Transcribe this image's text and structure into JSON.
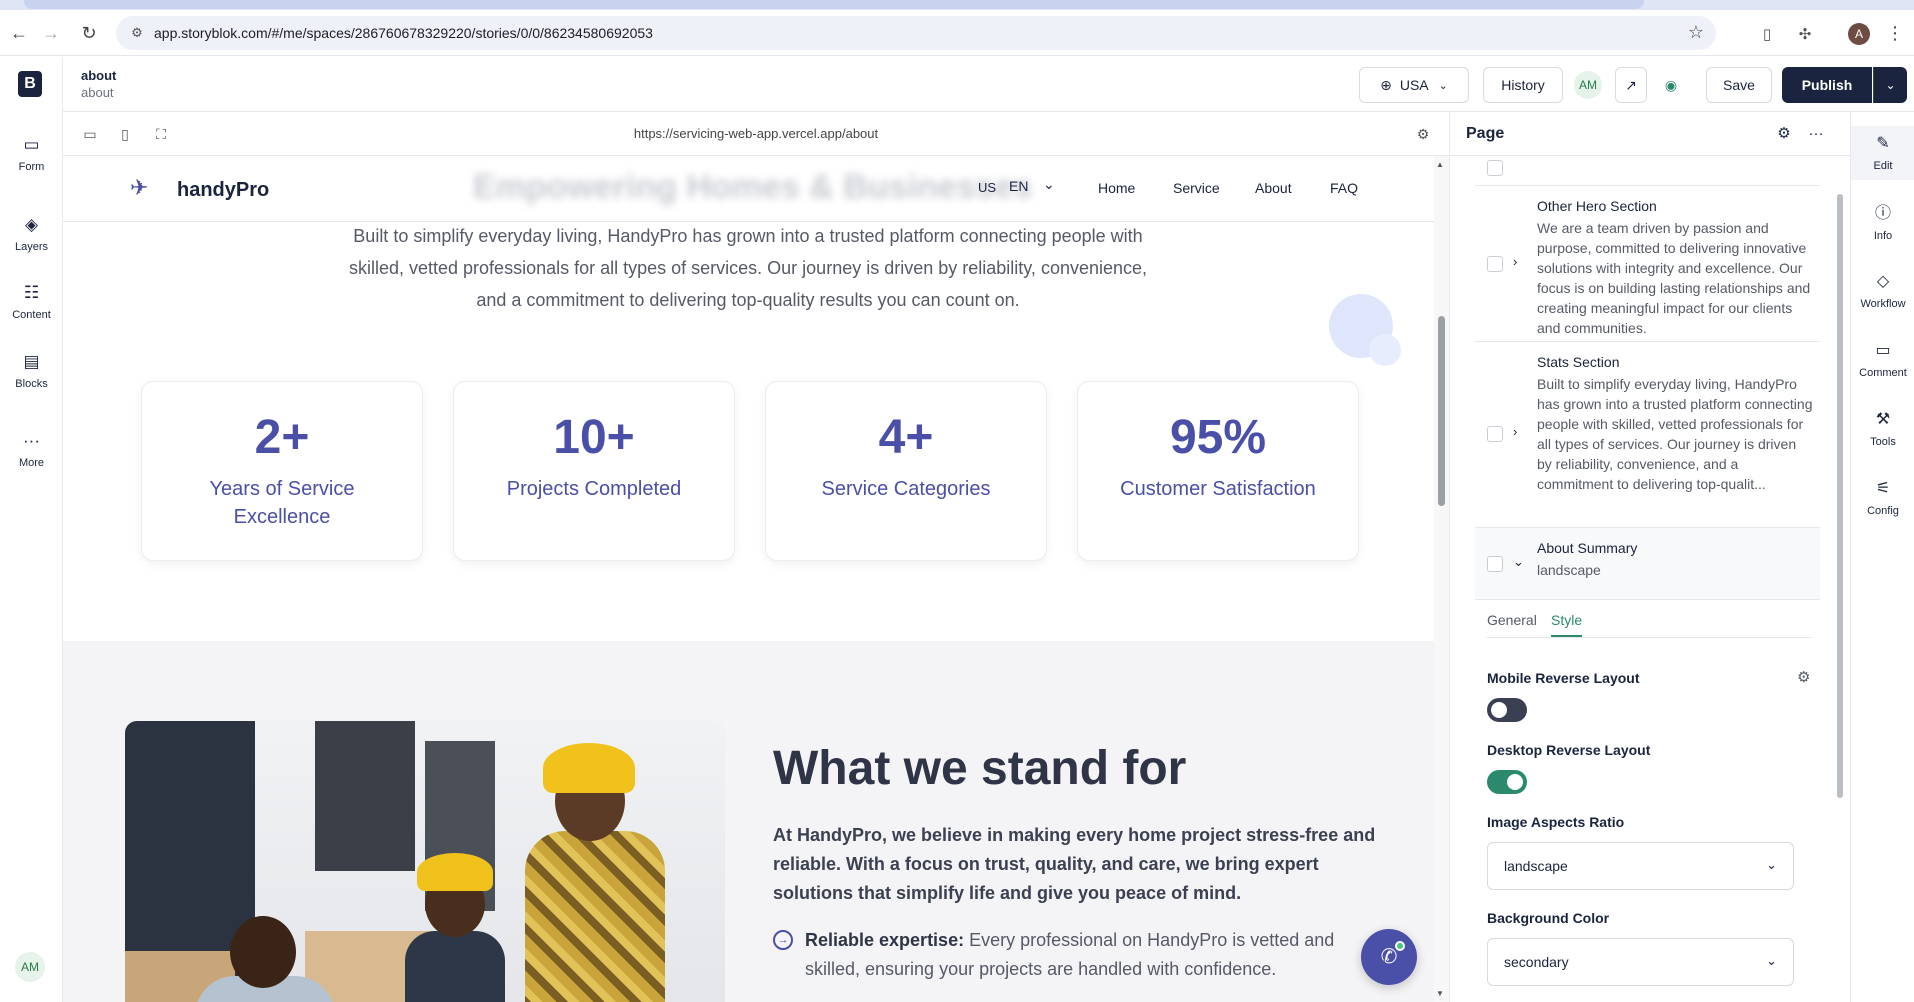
{
  "browser": {
    "url": "app.storyblok.com/#/me/spaces/286760678329220/stories/0/0/86234580692053",
    "profile_initial": "A"
  },
  "leftrail": {
    "logo": "B",
    "items": [
      {
        "label": "Form",
        "icon": "form-icon"
      },
      {
        "label": "Layers",
        "icon": "layers-icon"
      },
      {
        "label": "Content",
        "icon": "content-icon"
      },
      {
        "label": "Blocks",
        "icon": "blocks-icon"
      },
      {
        "label": "More",
        "icon": "more-icon"
      }
    ],
    "user_initials": "AM"
  },
  "header": {
    "story_name": "about",
    "story_slug": "about",
    "language_label": "USA",
    "history_label": "History",
    "collaborator_initials": "AM",
    "save_label": "Save",
    "publish_label": "Publish"
  },
  "preview_bar": {
    "url": "https://servicing-web-app.vercel.app/about"
  },
  "site": {
    "brand": "handyPro",
    "blurred_heading": "Empowering Homes & Businesses",
    "lang_region": "US",
    "lang_code": "EN",
    "nav": [
      "Home",
      "Service",
      "About",
      "FAQ"
    ],
    "intro": "Built to simplify everyday living, HandyPro has grown into a trusted platform connecting people with skilled, vetted professionals for all types of services. Our journey is driven by reliability, convenience, and a commitment to delivering top-quality results you can count on.",
    "stats": [
      {
        "value": "2+",
        "label": "Years of Service Excellence"
      },
      {
        "value": "10+",
        "label": "Projects Completed"
      },
      {
        "value": "4+",
        "label": "Service Categories"
      },
      {
        "value": "95%",
        "label": "Customer Satisfaction"
      }
    ],
    "values_title": "What we stand for",
    "values_lead": "At HandyPro, we believe in making every home project stress-free and reliable. With a focus on trust, quality, and care, we bring expert solutions that simplify life and give you peace of mind.",
    "value_item_title": "Reliable expertise:",
    "value_item_text": " Every professional on HandyPro is vetted and skilled, ensuring your projects are handled with confidence."
  },
  "panel": {
    "title": "Page",
    "blocks": [
      {
        "title": "Other Hero Section",
        "desc": "We are a team driven by passion and purpose, committed to delivering innovative solutions with integrity and excellence. Our focus is on building lasting relationships and creating meaningful impact for our clients and communities."
      },
      {
        "title": "Stats Section",
        "desc": "Built to simplify everyday living, HandyPro has grown into a trusted platform connecting people with skilled, vetted professionals for all types of services. Our journey is driven by reliability, convenience, and a commitment to delivering top-qualit..."
      },
      {
        "title": "About Summary",
        "desc": "landscape"
      }
    ],
    "tabs": [
      "General",
      "Style"
    ],
    "active_tab": "Style",
    "fields": {
      "mobile_reverse_label": "Mobile Reverse Layout",
      "mobile_reverse_on": false,
      "desktop_reverse_label": "Desktop Reverse Layout",
      "desktop_reverse_on": true,
      "aspect_label": "Image Aspects Ratio",
      "aspect_value": "landscape",
      "bg_label": "Background Color",
      "bg_value": "secondary"
    }
  },
  "toolrail": [
    {
      "label": "Edit",
      "icon": "pencil-icon"
    },
    {
      "label": "Info",
      "icon": "info-icon"
    },
    {
      "label": "Workflow",
      "icon": "workflow-icon"
    },
    {
      "label": "Comment",
      "icon": "comment-icon"
    },
    {
      "label": "Tools",
      "icon": "tools-icon"
    },
    {
      "label": "Config",
      "icon": "config-icon"
    }
  ],
  "colors": {
    "brand_navy": "#1b243f",
    "accent_purple": "#4a4fa8",
    "accent_green": "#2b8a6e"
  }
}
